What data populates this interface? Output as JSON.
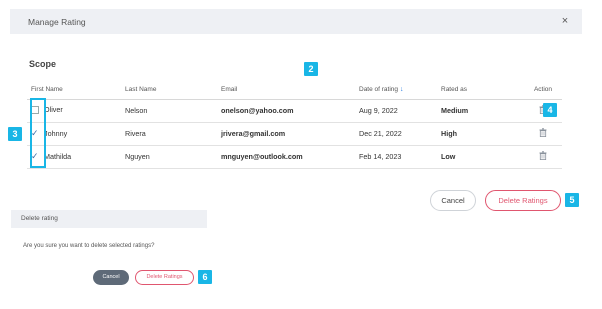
{
  "modal": {
    "title": "Manage Rating",
    "close_icon": "×"
  },
  "scope": {
    "title": "Scope",
    "columns": [
      "First Name",
      "Last Name",
      "Email",
      "Date of rating",
      "Rated as",
      "Action"
    ],
    "rows": [
      {
        "first": "Oliver",
        "last": "Nelson",
        "email": "onelson@yahoo.com",
        "date": "Aug 9, 2022",
        "rated": "Medium",
        "checked": false
      },
      {
        "first": "Johnny",
        "last": "Rivera",
        "email": "jrivera@gmail.com",
        "date": "Dec 21, 2022",
        "rated": "High",
        "checked": true
      },
      {
        "first": "Mathilda",
        "last": "Nguyen",
        "email": "mnguyen@outlook.com",
        "date": "Feb 14, 2023",
        "rated": "Low",
        "checked": true
      }
    ]
  },
  "actions": {
    "cancel_label": "Cancel",
    "delete_label": "Delete Ratings"
  },
  "dialog": {
    "title": "Delete rating",
    "message": "Are you sure you want to delete selected ratings?",
    "cancel_label": "Cancel",
    "delete_label": "Delete Ratings"
  },
  "markers": {
    "m2": "2",
    "m3": "3",
    "m4": "4",
    "m5": "5",
    "m6": "6"
  },
  "colors": {
    "marker": "#19b6e6",
    "danger": "#e0566f",
    "header_bg": "#eef0f4",
    "checkmark": "#3b6ea8",
    "dark_button": "#5e6a78"
  },
  "icons": {
    "trash": "trash-icon",
    "sort": "sort-down-icon",
    "close": "close-icon",
    "check": "checkmark-icon"
  }
}
